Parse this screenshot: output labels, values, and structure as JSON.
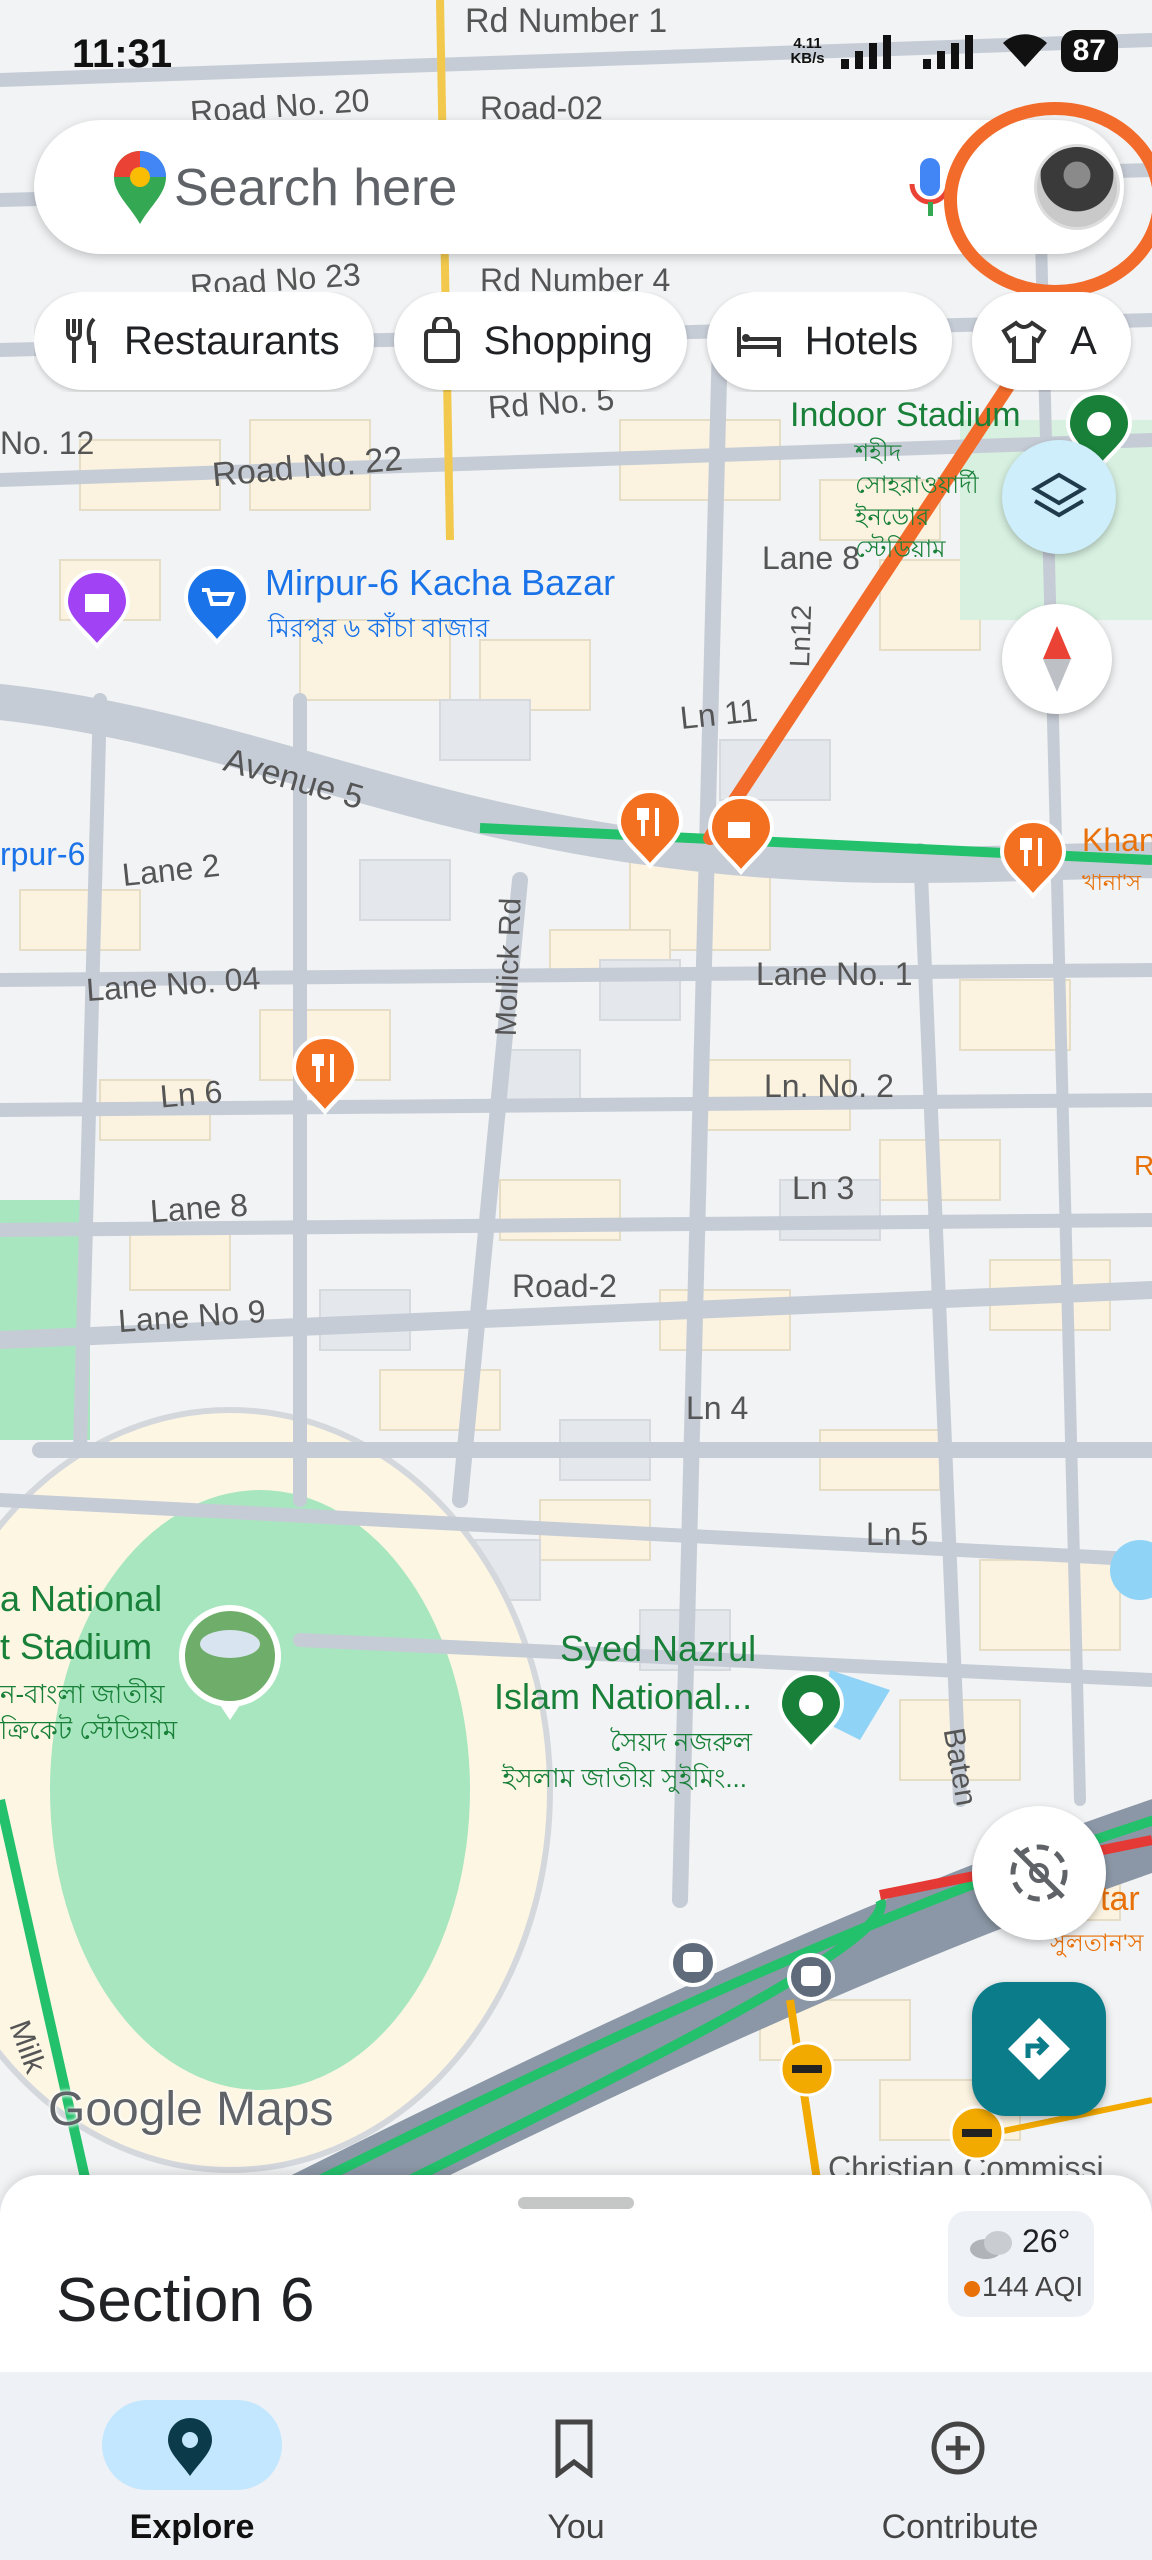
{
  "status_bar": {
    "time": "11:31",
    "net_speed_value": "4.11",
    "net_speed_unit": "KB/s",
    "battery": "87"
  },
  "search": {
    "placeholder": "Search here"
  },
  "chips": [
    {
      "label": "Restaurants",
      "icon": "fork-knife-icon"
    },
    {
      "label": "Shopping",
      "icon": "shopping-bag-icon"
    },
    {
      "label": "Hotels",
      "icon": "bed-icon"
    },
    {
      "label": "A",
      "icon": "shirt-icon"
    }
  ],
  "map_labels": {
    "rd_number_1": "Rd Number 1",
    "road_no_20": "Road No. 20",
    "road_02": "Road-02",
    "road_no_23": "Road No 23",
    "rd_number_4": "Rd Number 4",
    "rd_no_5": "Rd No. 5",
    "no_12": "No. 12",
    "road_no_22": "Road No. 22",
    "indoor_stadium": "Indoor Stadium",
    "indoor_stadium_bn": "শহীদ সোহরাওয়ার্দী ইনডোর স্টেডিয়াম",
    "kacha_bazar": "Mirpur-6 Kacha Bazar",
    "kacha_bazar_bn": "মিরপুর ৬ কাঁচা বাজার",
    "lane_8_top": "Lane 8",
    "ln_12": "Ln12",
    "ln_11": "Ln 11",
    "avenue_5": "Avenue 5",
    "mirpur_6": "rpur-6",
    "lane_2": "Lane 2",
    "khan": "Khan",
    "khan_bn": "খানা'স",
    "mollick_rd": "Mollick Rd",
    "lane_no_1": "Lane No. 1",
    "lane_no_04": "Lane No. 04",
    "ln_6": "Ln 6",
    "ln_no_2": "Ln. No. 2",
    "ln_3": "Ln 3",
    "lane_8_bottom": "Lane 8",
    "road_2": "Road-2",
    "lane_no_9": "Lane No 9",
    "ln_4": "Ln 4",
    "ln_5": "Ln 5",
    "stadium_1": "a National",
    "stadium_2": "t Stadium",
    "stadium_bn_1": "ন-বাংলা জাতীয়",
    "stadium_bn_2": "ক্রিকেট স্টেডিয়াম",
    "swimming_1": "Syed Nazrul",
    "swimming_2": "Islam National...",
    "swimming_bn_1": "সৈয়দ নজরুল",
    "swimming_bn_2": "ইসলাম জাতীয় সুইমিং...",
    "baten": "Baten",
    "sultan": "tar",
    "sultan_bn": "সুলতান'স",
    "christian": "Christian Commissi",
    "milk": "Milk",
    "r_edge": "R"
  },
  "branding": {
    "logo_google": "Google",
    "logo_maps": "Maps"
  },
  "sheet": {
    "title": "Section 6",
    "temperature": "26°",
    "aqi": "144 AQI"
  },
  "nav": [
    {
      "label": "Explore",
      "icon": "location-pin-icon",
      "active": true
    },
    {
      "label": "You",
      "icon": "bookmark-icon",
      "active": false
    },
    {
      "label": "Contribute",
      "icon": "plus-circle-icon",
      "active": false
    }
  ],
  "colors": {
    "highlight": "#f26b2a",
    "road_traffic_green": "#23c16b",
    "directions_button": "#0b7d8a",
    "restaurant_pin": "#f37021",
    "park": "#a8e6bf"
  }
}
